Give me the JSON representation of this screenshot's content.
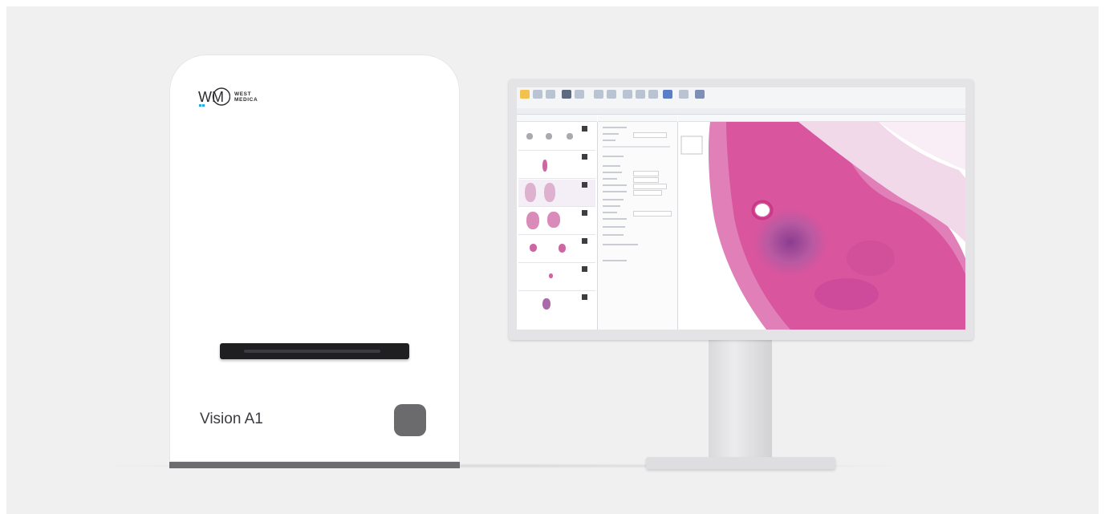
{
  "scanner": {
    "brand_lines": [
      "WEST",
      "MEDICA"
    ],
    "logo_mark": "WM",
    "model": "Vision A1"
  },
  "colors": {
    "background": "#f0f0f1",
    "scanner_body": "#ffffff",
    "scanner_base": "#6d6d70",
    "tissue_stain": "#d9559e",
    "brand_accent": "#2aa8e0"
  },
  "icons": [
    "west-medica-logo-icon",
    "power-button-icon",
    "slide-slot-icon"
  ]
}
